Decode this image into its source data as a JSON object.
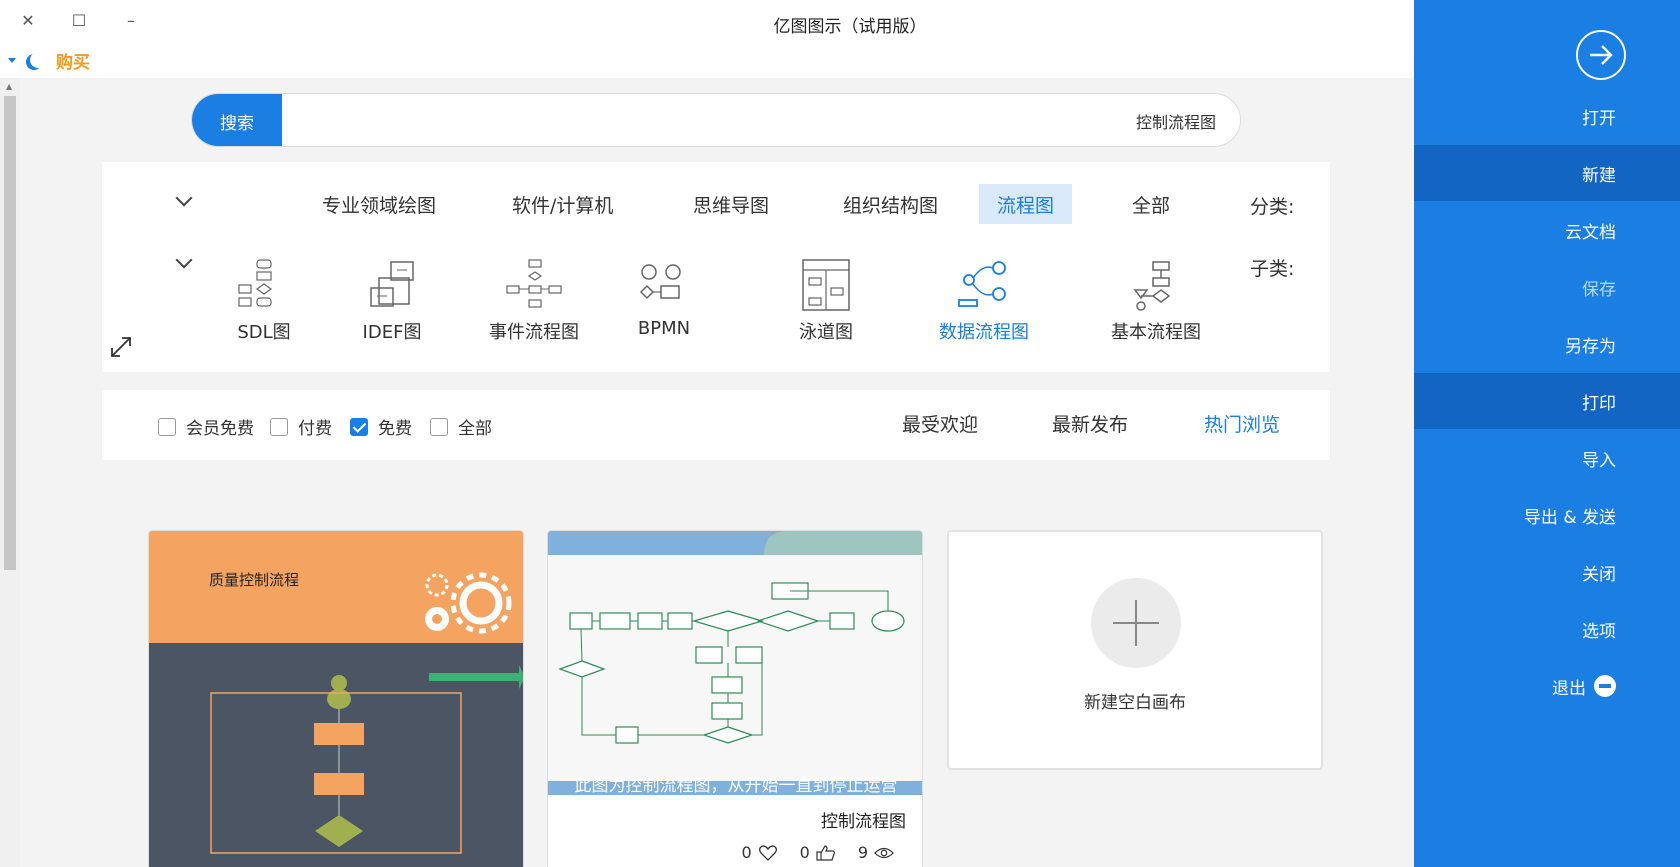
{
  "window": {
    "title": "亿图图示（试用版）",
    "buy_label": "购买"
  },
  "sidebar": {
    "items": [
      {
        "label": "打开"
      },
      {
        "label": "新建"
      },
      {
        "label": "云文档"
      },
      {
        "label": "保存"
      },
      {
        "label": "另存为"
      },
      {
        "label": "打印"
      },
      {
        "label": "导入"
      },
      {
        "label": "导出 & 发送"
      },
      {
        "label": "关闭"
      },
      {
        "label": "选项"
      },
      {
        "label": "退出"
      }
    ],
    "active": "新建"
  },
  "search": {
    "button_label": "搜索",
    "query": "控制流程图"
  },
  "categories": {
    "label": "分类:",
    "items": [
      "全部",
      "流程图",
      "组织结构图",
      "思维导图",
      "软件/计算机",
      "专业领域绘图"
    ],
    "active": "流程图"
  },
  "subcategories": {
    "label": "子类:",
    "items": [
      "基本流程图",
      "数据流程图",
      "泳道图",
      "BPMN",
      "事件流程图",
      "IDEF图",
      "SDL图"
    ],
    "active": "数据流程图"
  },
  "sort": {
    "items": [
      "热门浏览",
      "最新发布",
      "最受欢迎"
    ],
    "active": "热门浏览"
  },
  "price_filter": {
    "items": [
      {
        "label": "全部",
        "checked": false
      },
      {
        "label": "免费",
        "checked": true
      },
      {
        "label": "付费",
        "checked": false
      },
      {
        "label": "会员免费",
        "checked": false
      }
    ]
  },
  "cards": {
    "card1": {
      "thumb_title": "质量控制流程"
    },
    "card2": {
      "thumb_caption": "此图为控制流程图，从开始一直到停止运营",
      "title": "控制流程图",
      "views": "9",
      "likes": "0",
      "favorites": "0"
    },
    "new_blank": {
      "label": "新建空白画布"
    }
  },
  "colors": {
    "accent": "#1a7ee3",
    "sidebar_active": "#1365c3",
    "buy": "#f29b1d"
  }
}
